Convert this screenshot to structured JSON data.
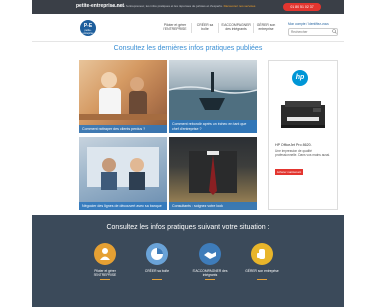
{
  "topbar": {
    "site": "petite-entreprise.net",
    "tagline": "Le site de l'entrepreneur, les infos pratiques et les réponses de juristes et d'experts.",
    "tagline_link": "Découvrez nos services",
    "phone": "01 80 51 02 37"
  },
  "header": {
    "logo_main": "P-E",
    "logo_sub": "petite-entreprise",
    "nav": [
      {
        "label": "Piloter et gérer l'ENTREPRISE"
      },
      {
        "label": "CRÉER sa boîte"
      },
      {
        "label": "S'ACCOMPAGNER des intégrants"
      },
      {
        "label": "GÉRER son entreprise"
      }
    ],
    "account": "Mon compte / Identifiez-vous",
    "search_placeholder": "Rechercher"
  },
  "headline": "Consultez les dernières infos pratiques publiées",
  "tiles": [
    {
      "caption": "Comment rattraper des clients perdus ?"
    },
    {
      "caption": "Comment rebondir après un échec en tant que chef d'entreprise ?"
    },
    {
      "caption": "Négocier des lignes de découvert avec sa banque"
    },
    {
      "caption": "Consultants : soignez votre look"
    }
  ],
  "ad": {
    "brand": "hp",
    "product": "HP OfficeJet Pro 8620.",
    "description": "Une impression de qualité professionnelle. Dans vos mains aussi.",
    "cta": "Acheter maintenant"
  },
  "band": {
    "title": "Consultez les infos pratiques suivant votre situation :",
    "items": [
      {
        "label": "Piloter et gérer l'ENTREPRISE"
      },
      {
        "label": "CRÉER sa boîte"
      },
      {
        "label": "S'ACCOMPAGNER des intégrants"
      },
      {
        "label": "GÉRER son entreprise"
      }
    ]
  },
  "colors": {
    "topbar": "#3a3f47",
    "accent_blue": "#3a8fd4",
    "phone_red": "#e3352f",
    "band": "#3b4a5a"
  }
}
